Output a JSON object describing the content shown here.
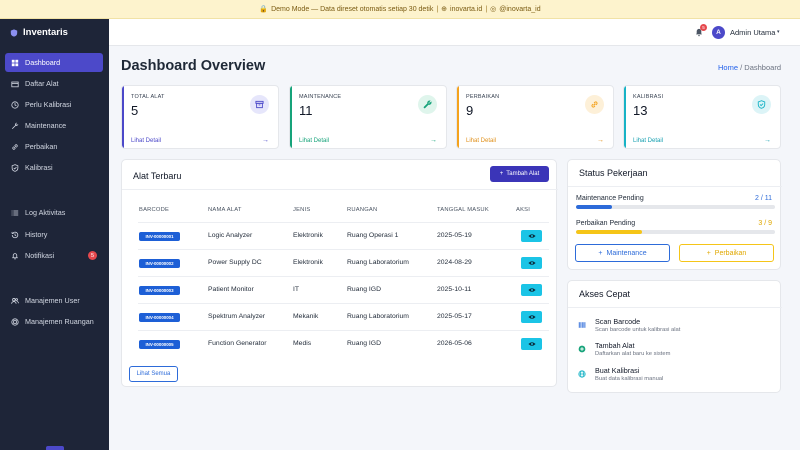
{
  "banner": {
    "demo_text": "Demo Mode — Data direset otomatis setiap 30 detik",
    "separator": "|",
    "site": "inovarta.id",
    "social": "@inovarta_id"
  },
  "brand": {
    "name": "Inventaris"
  },
  "sidebar": {
    "items": [
      {
        "label": "Dashboard",
        "icon": "grid-icon",
        "active": true
      },
      {
        "label": "Daftar Alat",
        "icon": "box-icon"
      },
      {
        "label": "Perlu Kalibrasi",
        "icon": "clock-icon"
      },
      {
        "label": "Maintenance",
        "icon": "wrench-icon"
      },
      {
        "label": "Perbaikan",
        "icon": "link-icon"
      },
      {
        "label": "Kalibrasi",
        "icon": "shield-check-icon"
      },
      {
        "label": "Log Aktivitas",
        "icon": "list-icon"
      },
      {
        "label": "History",
        "icon": "history-icon"
      },
      {
        "label": "Notifikasi",
        "icon": "bell-icon",
        "badge": "5"
      },
      {
        "label": "Manajemen User",
        "icon": "users-icon"
      },
      {
        "label": "Manajemen Ruangan",
        "icon": "building-icon"
      }
    ]
  },
  "topbar": {
    "notif_count": "5",
    "avatar_initial": "A",
    "user_name": "Admin Utama",
    "caret": "▾"
  },
  "page": {
    "title": "Dashboard Overview",
    "breadcrumb_home": "Home",
    "breadcrumb_sep": "/",
    "breadcrumb_current": "Dashboard"
  },
  "stats": [
    {
      "label": "TOTAL ALAT",
      "value": "5",
      "link": "Lihat Detail",
      "arrow": "→",
      "color": "#4c49c9",
      "icon": "archive-icon"
    },
    {
      "label": "MAINTENANCE",
      "value": "11",
      "link": "Lihat Detail",
      "arrow": "→",
      "color": "#16a37a",
      "icon": "wrench-icon"
    },
    {
      "label": "PERBAIKAN",
      "value": "9",
      "link": "Lihat Detail",
      "arrow": "→",
      "color": "#f4a21d",
      "icon": "link-icon"
    },
    {
      "label": "KALIBRASI",
      "value": "13",
      "link": "Lihat Detail",
      "arrow": "→",
      "color": "#17b3c6",
      "icon": "shield-check-icon"
    }
  ],
  "recent": {
    "title": "Alat Terbaru",
    "add_button": "Tambah Alat",
    "add_plus": "+",
    "headers": [
      "BARCODE",
      "NAMA ALAT",
      "JENIS",
      "RUANGAN",
      "TANGGAL MASUK",
      "AKSI"
    ],
    "rows": [
      {
        "barcode": "INV-00000001",
        "name": "Logic Analyzer",
        "type": "Elektronik",
        "room": "Ruang Operasi 1",
        "date": "2025-05-19"
      },
      {
        "barcode": "INV-00000002",
        "name": "Power Supply DC",
        "type": "Elektronik",
        "room": "Ruang Laboratorium",
        "date": "2024-08-29"
      },
      {
        "barcode": "INV-00000003",
        "name": "Patient Monitor",
        "type": "IT",
        "room": "Ruang IGD",
        "date": "2025-10-11"
      },
      {
        "barcode": "INV-00000004",
        "name": "Spektrum Analyzer",
        "type": "Mekanik",
        "room": "Ruang Laboratorium",
        "date": "2025-05-17"
      },
      {
        "barcode": "INV-00000005",
        "name": "Function Generator",
        "type": "Medis",
        "room": "Ruang IGD",
        "date": "2026-05-06"
      }
    ],
    "view_all": "Lihat Semua"
  },
  "status": {
    "title": "Status Pekerjaan",
    "items": [
      {
        "label": "Maintenance Pending",
        "value": "2 / 11",
        "progress": 0.18,
        "color": "#2d6bd9"
      },
      {
        "label": "Perbaikan Pending",
        "value": "3 / 9",
        "progress": 0.33,
        "color": "#f5c518"
      }
    ],
    "btn_maintenance": "Maintenance",
    "btn_perbaikan": "Perbaikan",
    "plus": "+"
  },
  "quick": {
    "title": "Akses Cepat",
    "items": [
      {
        "title": "Scan Barcode",
        "sub": "Scan barcode untuk kalibrasi alat",
        "icon": "barcode-icon"
      },
      {
        "title": "Tambah Alat",
        "sub": "Daftarkan alat baru ke sistem",
        "icon": "plus-circle-icon"
      },
      {
        "title": "Buat Kalibrasi",
        "sub": "Buat data kalibrasi manual",
        "icon": "globe-icon"
      }
    ]
  }
}
